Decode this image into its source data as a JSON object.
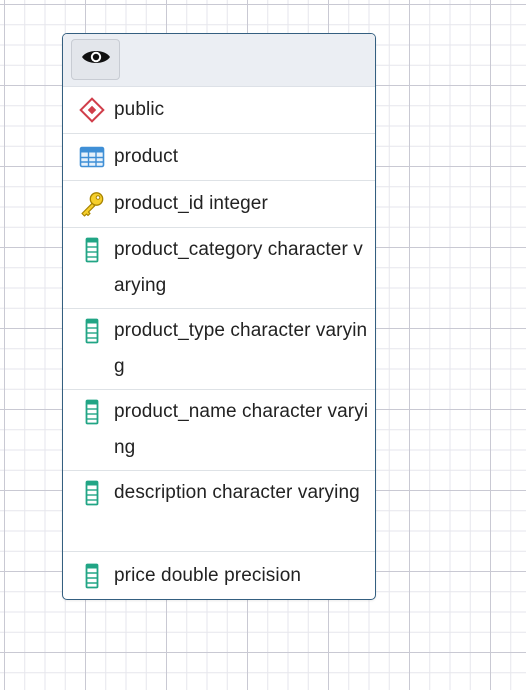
{
  "node": {
    "toggle_icon": "eye-icon",
    "schema": {
      "label": "public",
      "icon": "schema-diamond-icon",
      "color": "#d03e4a"
    },
    "table": {
      "label": "product",
      "icon": "table-icon",
      "color": "#3f8fd6"
    },
    "primary_key": {
      "label": "product_id integer",
      "icon": "key-icon",
      "color": "#e3b400"
    },
    "columns": [
      {
        "label": "product_category character varying",
        "icon": "column-icon"
      },
      {
        "label": "product_type character varying",
        "icon": "column-icon"
      },
      {
        "label": "product_name character varying",
        "icon": "column-icon"
      },
      {
        "label": "description character varying",
        "icon": "column-icon"
      },
      {
        "label": "price double precision",
        "icon": "column-icon"
      }
    ],
    "column_icon_color": "#21a585"
  }
}
